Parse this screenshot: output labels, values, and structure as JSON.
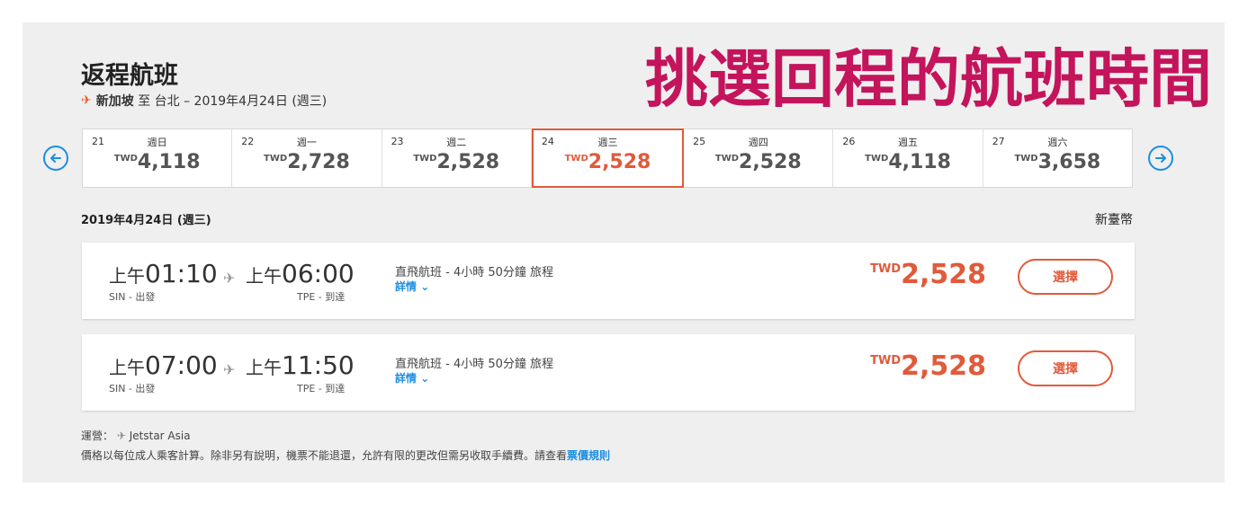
{
  "overlay_text": "挑選回程的航班時間",
  "header": {
    "title": "返程航班",
    "route_from": "新加坡",
    "route_to_word": "至",
    "route_to": "台北",
    "route_date": "– 2019年4月24日 (週三)"
  },
  "date_strip": [
    {
      "day": "21",
      "weekday": "週日",
      "currency": "TWD",
      "price": "4,118",
      "selected": false
    },
    {
      "day": "22",
      "weekday": "週一",
      "currency": "TWD",
      "price": "2,728",
      "selected": false
    },
    {
      "day": "23",
      "weekday": "週二",
      "currency": "TWD",
      "price": "2,528",
      "selected": false
    },
    {
      "day": "24",
      "weekday": "週三",
      "currency": "TWD",
      "price": "2,528",
      "selected": true
    },
    {
      "day": "25",
      "weekday": "週四",
      "currency": "TWD",
      "price": "2,528",
      "selected": false
    },
    {
      "day": "26",
      "weekday": "週五",
      "currency": "TWD",
      "price": "4,118",
      "selected": false
    },
    {
      "day": "27",
      "weekday": "週六",
      "currency": "TWD",
      "price": "3,658",
      "selected": false
    }
  ],
  "listing": {
    "date_heading": "2019年4月24日 (週三)",
    "currency_label": "新臺幣"
  },
  "flights": [
    {
      "dep_period": "上午",
      "dep_time": "01:10",
      "dep_code": "SIN - 出發",
      "arr_period": "上午",
      "arr_time": "06:00",
      "arr_code": "TPE - 到達",
      "description": "直飛航班 - 4小時 50分鐘 旅程",
      "details_label": "詳情",
      "currency": "TWD",
      "price": "2,528",
      "select_label": "選擇"
    },
    {
      "dep_period": "上午",
      "dep_time": "07:00",
      "dep_code": "SIN - 出發",
      "arr_period": "上午",
      "arr_time": "11:50",
      "arr_code": "TPE - 到達",
      "description": "直飛航班 - 4小時 50分鐘 旅程",
      "details_label": "詳情",
      "currency": "TWD",
      "price": "2,528",
      "select_label": "選擇"
    }
  ],
  "footer": {
    "operator_label": "運營：",
    "operator_name": "Jetstar Asia",
    "note": "價格以每位成人乘客計算。除非另有說明，機票不能退還，允許有限的更改但需另收取手續費。請查看",
    "fare_rules_link": "票價規則"
  },
  "colors": {
    "accent": "#e15a3a",
    "link": "#1c8ee0",
    "overlay": "#c4145b",
    "panel_bg": "#efefef"
  },
  "icons": [
    "plane-icon",
    "arrow-left-icon",
    "arrow-right-icon",
    "chevron-down-icon"
  ]
}
